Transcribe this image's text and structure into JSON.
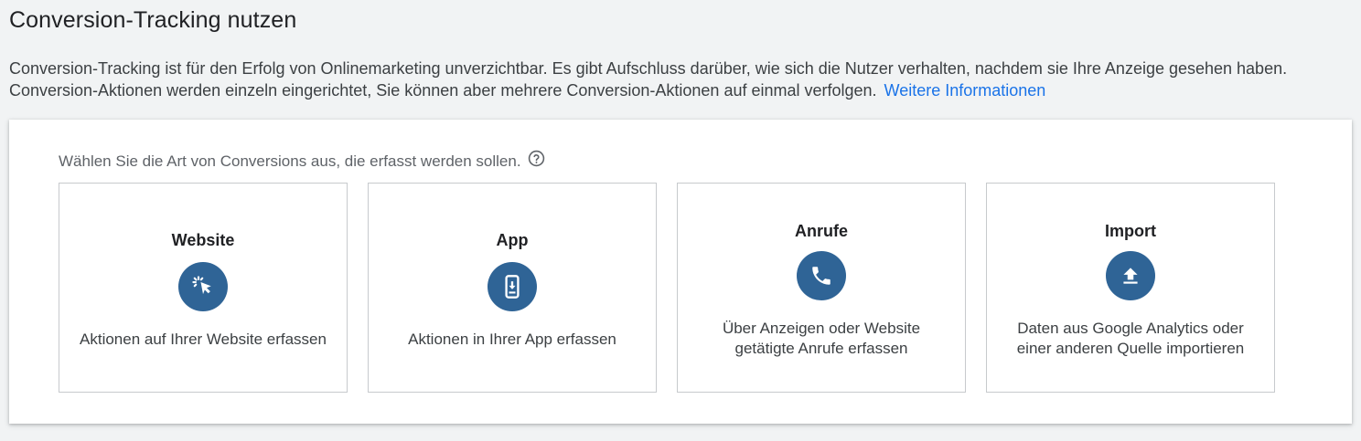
{
  "header": {
    "title": "Conversion-Tracking nutzen",
    "intro_text": "Conversion-Tracking ist für den Erfolg von Onlinemarketing unverzichtbar. Es gibt Aufschluss darüber, wie sich die Nutzer verhalten, nachdem sie Ihre Anzeige gesehen haben. Conversion-Aktionen werden einzeln eingerichtet, Sie können aber mehrere Conversion-Aktionen auf einmal verfolgen.",
    "learn_more_link": "Weitere Informationen"
  },
  "panel": {
    "prompt": "Wählen Sie die Art von Conversions aus, die erfasst werden sollen.",
    "help_icon": "help-circle-icon",
    "cards": [
      {
        "title": "Website",
        "icon": "cursor-click-icon",
        "description": "Aktionen auf Ihrer Website erfassen"
      },
      {
        "title": "App",
        "icon": "phone-download-icon",
        "description": "Aktionen in Ihrer App erfassen"
      },
      {
        "title": "Anrufe",
        "icon": "phone-call-icon",
        "description": "Über Anzeigen oder Website getätigte Anrufe erfassen"
      },
      {
        "title": "Import",
        "icon": "upload-icon",
        "description": "Daten aus Google Analytics oder einer anderen Quelle importieren"
      }
    ]
  },
  "colors": {
    "accent_icon_bg": "#2f6496",
    "link": "#1a73e8",
    "page_bg": "#f1f3f4"
  }
}
